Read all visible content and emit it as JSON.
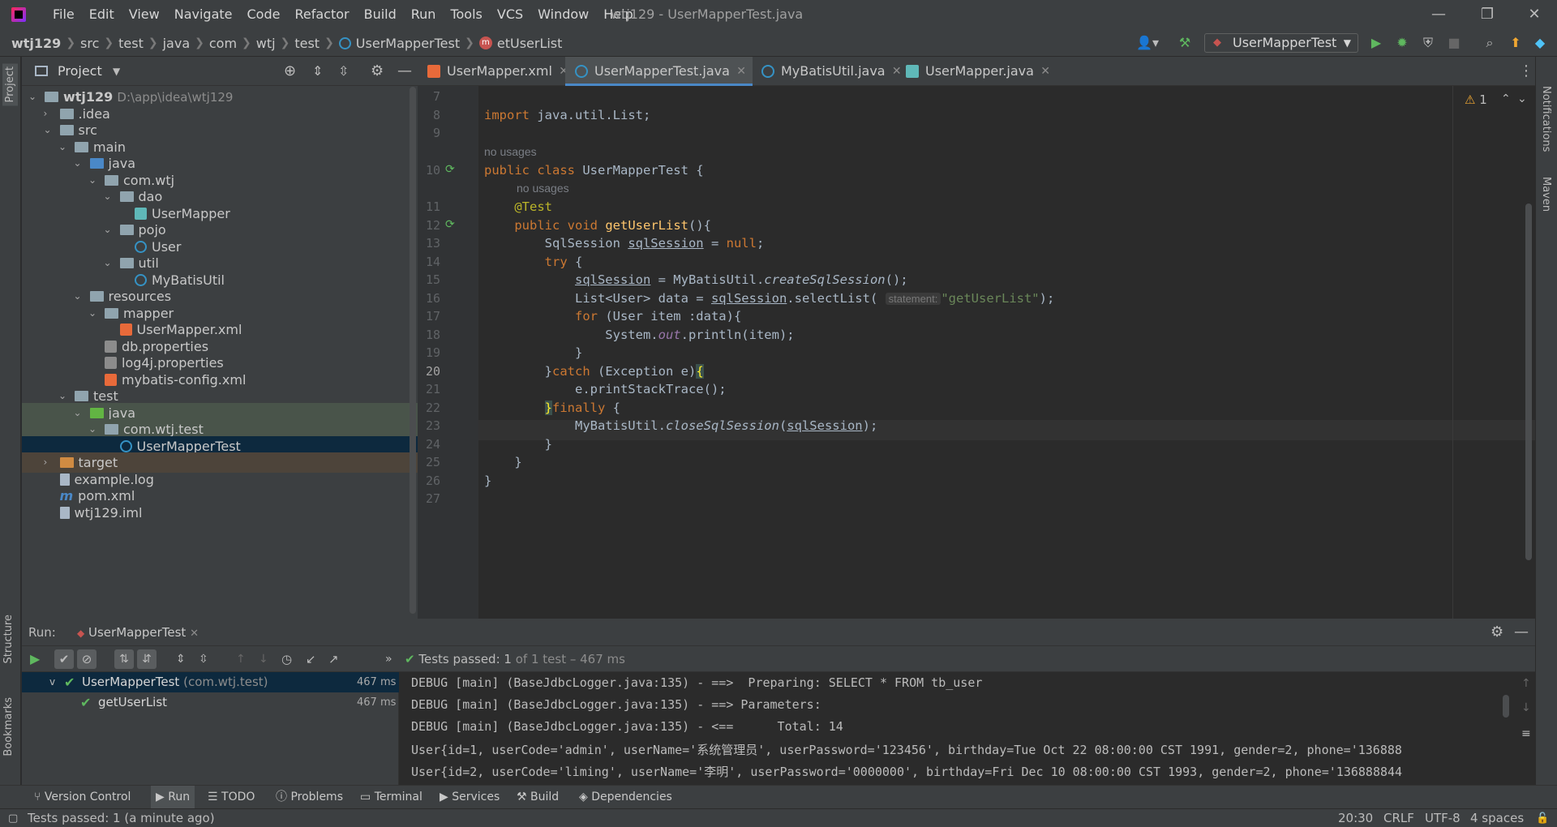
{
  "menu": [
    "File",
    "Edit",
    "View",
    "Navigate",
    "Code",
    "Refactor",
    "Build",
    "Run",
    "Tools",
    "VCS",
    "Window",
    "Help"
  ],
  "window_title": "wtj129 - UserMapperTest.java",
  "breadcrumb": [
    "wtj129",
    "src",
    "test",
    "java",
    "com",
    "wtj",
    "test",
    "UserMapperTest",
    "etUserList"
  ],
  "run_config": "UserMapperTest",
  "project": {
    "title": "Project",
    "tree": [
      {
        "label": "wtj129",
        "extra": "D:\\app\\idea\\wtj129",
        "depth": 0,
        "type": "folder",
        "arrow": "v"
      },
      {
        "label": ".idea",
        "depth": 1,
        "type": "folder",
        "arrow": ">"
      },
      {
        "label": "src",
        "depth": 1,
        "type": "folder",
        "arrow": "v"
      },
      {
        "label": "main",
        "depth": 2,
        "type": "folder",
        "arrow": "v"
      },
      {
        "label": "java",
        "depth": 3,
        "type": "folder-blue",
        "arrow": "v"
      },
      {
        "label": "com.wtj",
        "depth": 4,
        "type": "folder",
        "arrow": "v"
      },
      {
        "label": "dao",
        "depth": 5,
        "type": "folder",
        "arrow": "v"
      },
      {
        "label": "UserMapper",
        "depth": 6,
        "type": "mapper"
      },
      {
        "label": "pojo",
        "depth": 5,
        "type": "folder",
        "arrow": "v"
      },
      {
        "label": "User",
        "depth": 6,
        "type": "java"
      },
      {
        "label": "util",
        "depth": 5,
        "type": "folder",
        "arrow": "v"
      },
      {
        "label": "MyBatisUtil",
        "depth": 6,
        "type": "java"
      },
      {
        "label": "resources",
        "depth": 3,
        "type": "folder",
        "arrow": "v"
      },
      {
        "label": "mapper",
        "depth": 4,
        "type": "folder",
        "arrow": "v"
      },
      {
        "label": "UserMapper.xml",
        "depth": 5,
        "type": "xml"
      },
      {
        "label": "db.properties",
        "depth": 4,
        "type": "prop"
      },
      {
        "label": "log4j.properties",
        "depth": 4,
        "type": "prop"
      },
      {
        "label": "mybatis-config.xml",
        "depth": 4,
        "type": "xml"
      },
      {
        "label": "test",
        "depth": 2,
        "type": "folder",
        "arrow": "v"
      },
      {
        "label": "java",
        "depth": 3,
        "type": "folder-green",
        "arrow": "v",
        "hl": "test"
      },
      {
        "label": "com.wtj.test",
        "depth": 4,
        "type": "folder",
        "arrow": "v",
        "hl": "test"
      },
      {
        "label": "UserMapperTest",
        "depth": 5,
        "type": "java",
        "hl": "sel"
      },
      {
        "label": "target",
        "depth": 1,
        "type": "folder-orange",
        "arrow": ">",
        "hl": "target"
      },
      {
        "label": "example.log",
        "depth": 1,
        "type": "file"
      },
      {
        "label": "pom.xml",
        "depth": 1,
        "type": "maven"
      },
      {
        "label": "wtj129.iml",
        "depth": 1,
        "type": "file"
      }
    ]
  },
  "tabs": [
    {
      "label": "UserMapper.xml",
      "icon": "xml"
    },
    {
      "label": "UserMapperTest.java",
      "icon": "java",
      "active": true
    },
    {
      "label": "MyBatisUtil.java",
      "icon": "java"
    },
    {
      "label": "UserMapper.java",
      "icon": "mapper"
    }
  ],
  "editor": {
    "warnings": "1",
    "hint_no_usages": "no usages",
    "param_hint": "statement:",
    "line_numbers": [
      "7",
      "8",
      "9",
      "10",
      "11",
      "12",
      "13",
      "14",
      "15",
      "16",
      "17",
      "18",
      "19",
      "20",
      "21",
      "22",
      "23",
      "24",
      "25",
      "26",
      "27"
    ]
  },
  "run": {
    "label": "Run:",
    "tab": "UserMapperTest",
    "status_prefix": "Tests passed:",
    "status_count": "1",
    "status_suffix": "of 1 test – 467 ms",
    "tree": [
      {
        "name": "UserMapperTest",
        "pkg": "(com.wtj.test)",
        "time": "467 ms"
      },
      {
        "name": "getUserList",
        "time": "467 ms"
      }
    ],
    "console": [
      "DEBUG [main] (BaseJdbcLogger.java:135) - ==>  Preparing: SELECT * FROM tb_user",
      "DEBUG [main] (BaseJdbcLogger.java:135) - ==> Parameters: ",
      "DEBUG [main] (BaseJdbcLogger.java:135) - <==      Total: 14",
      "User{id=1, userCode='admin', userName='系统管理员', userPassword='123456', birthday=Tue Oct 22 08:00:00 CST 1991, gender=2, phone='136888",
      "User{id=2, userCode='liming', userName='李明', userPassword='0000000', birthday=Fri Dec 10 08:00:00 CST 1993, gender=2, phone='136888844"
    ]
  },
  "toolwindows": [
    "Version Control",
    "Run",
    "TODO",
    "Problems",
    "Terminal",
    "Services",
    "Build",
    "Dependencies"
  ],
  "left_vtabs": [
    "Project",
    "Structure",
    "Bookmarks"
  ],
  "right_vtabs": [
    "Notifications",
    "Maven"
  ],
  "status": {
    "message": "Tests passed: 1 (a minute ago)",
    "position": "20:30",
    "line_sep": "CRLF",
    "encoding": "UTF-8",
    "indent": "4 spaces"
  }
}
